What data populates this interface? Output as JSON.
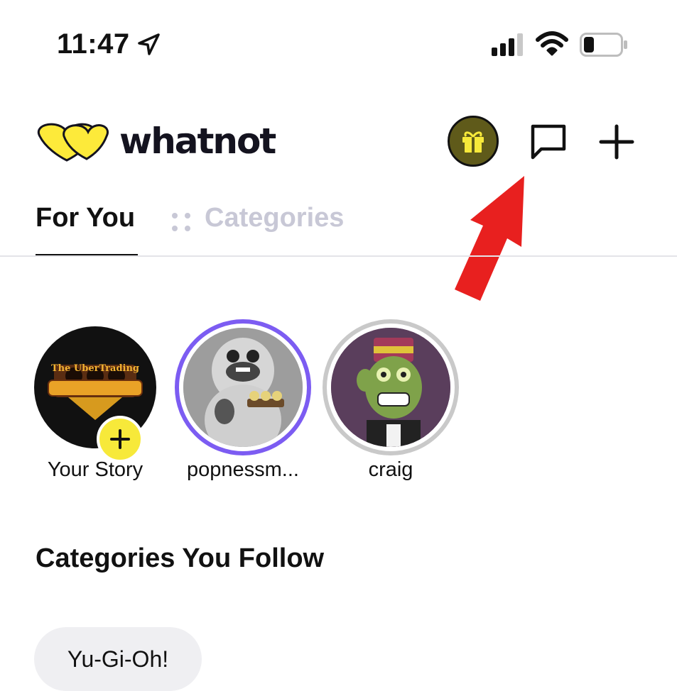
{
  "status_bar": {
    "time": "11:47",
    "icons": [
      "location-arrow-icon",
      "cellular-signal-icon",
      "wifi-icon",
      "battery-icon"
    ]
  },
  "header": {
    "brand": "whatnot",
    "brand_color": "#fdea3a",
    "actions": [
      "gift-icon",
      "message-icon",
      "plus-icon"
    ]
  },
  "tabs": [
    {
      "label": "For You",
      "active": true
    },
    {
      "label": "Categories",
      "active": false
    }
  ],
  "stories": [
    {
      "label": "Your Story",
      "avatar_text": "The UberTrading",
      "ring": "none"
    },
    {
      "label": "popnessm...",
      "ring": "#7c5cf2"
    },
    {
      "label": "craig",
      "ring": "#c9c9c9"
    }
  ],
  "section": {
    "title": "Categories You Follow"
  },
  "followed_categories": [
    "Yu-Gi-Oh!"
  ],
  "colors": {
    "accent_yellow": "#f7e93a",
    "annotation_red": "#e8201f",
    "inactive_tab": "#c8c8d6"
  }
}
